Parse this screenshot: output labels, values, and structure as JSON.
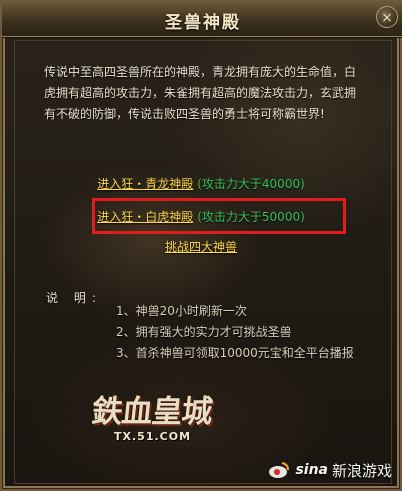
{
  "window": {
    "title": "圣兽神殿",
    "close_glyph": "×"
  },
  "intro": {
    "text": "传说中至高四圣兽所在的神殿，青龙拥有庞大的生命值，白虎拥有超高的攻击力，朱雀拥有超高的魔法攻击力，玄武拥有不破的防御，传说击败四圣兽的勇士将可称霸世界!"
  },
  "links": {
    "qinglong": {
      "label": "进入狂・青龙神殿",
      "note": "(攻击力大于40000)"
    },
    "baihu": {
      "label": "进入狂・白虎神殿",
      "note": "(攻击力大于50000)"
    },
    "challenge": {
      "label": "挑战四大神兽"
    }
  },
  "notes": {
    "label": "说 明:",
    "items": [
      "1、神兽20小时刷新一次",
      "2、拥有强大的实力才可挑战圣兽",
      "3、首杀神兽可领取10000元宝和全平台播报"
    ]
  },
  "logo": {
    "name": "鉄血皇城",
    "url": "TX.51.COM"
  },
  "watermark": {
    "brand": "sina",
    "text": "新浪游戏"
  },
  "colors": {
    "link": "#ffd94a",
    "attack_note": "#37c15a",
    "highlight_box": "#e21d1d"
  }
}
